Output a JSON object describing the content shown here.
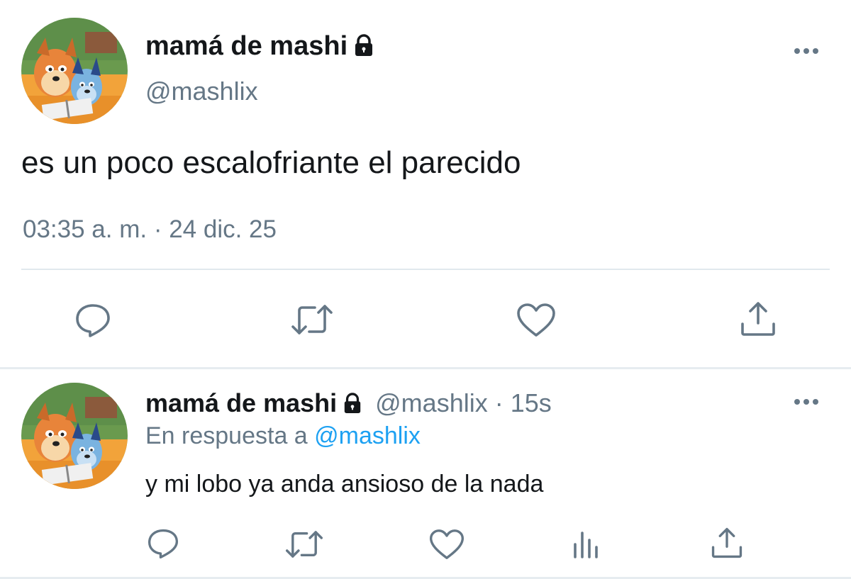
{
  "tweet": {
    "author": {
      "display_name": "mamá de mashi",
      "handle": "@mashlix",
      "protected": true,
      "avatar_icon": "avatar-cartoon-dogs-icon"
    },
    "text": "es un poco escalofriante el parecido",
    "timestamp": "03:35 a. m. · 24 dic. 25",
    "actions": [
      "reply-icon",
      "retweet-icon",
      "like-icon",
      "share-icon"
    ]
  },
  "reply": {
    "author": {
      "display_name": "mamá de mashi",
      "handle": "@mashlix",
      "protected": true,
      "avatar_icon": "avatar-cartoon-dogs-icon"
    },
    "meta_separator": " · ",
    "time_ago": "15s",
    "replying_to_label": "En respuesta a",
    "replying_to_handle": "@mashlix",
    "text": "y mi lobo ya anda ansioso de la nada",
    "actions": [
      "reply-icon",
      "retweet-icon",
      "like-icon",
      "analytics-icon",
      "share-icon"
    ]
  },
  "colors": {
    "text_primary": "#14171a",
    "text_secondary": "#657786",
    "link": "#1da1f2",
    "divider": "#e1e8ed"
  }
}
